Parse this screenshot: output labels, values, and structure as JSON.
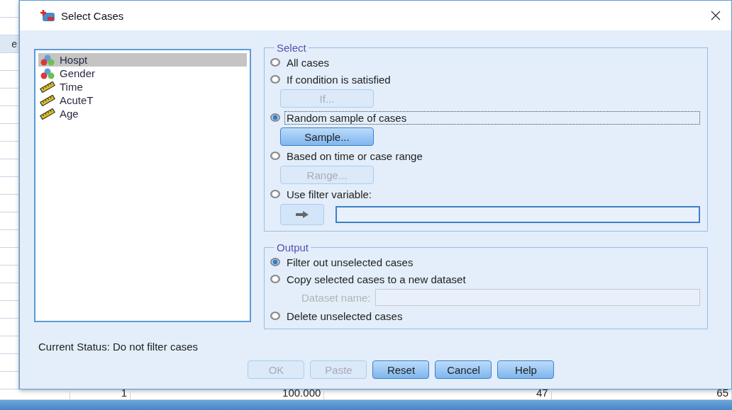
{
  "background": {
    "header_fragment": "e",
    "row": [
      "1",
      "100.000",
      "47",
      "65"
    ]
  },
  "window": {
    "title": "Select Cases"
  },
  "variables": [
    {
      "name": "Hospt",
      "kind": "nominal",
      "selected": true
    },
    {
      "name": "Gender",
      "kind": "nominal",
      "selected": false
    },
    {
      "name": "Time",
      "kind": "scale",
      "selected": false
    },
    {
      "name": "AcuteT",
      "kind": "scale",
      "selected": false
    },
    {
      "name": "Age",
      "kind": "scale",
      "selected": false
    }
  ],
  "select": {
    "title": "Select",
    "options": [
      {
        "kind": "radio",
        "label": "All cases",
        "selected": false
      },
      {
        "kind": "radio",
        "label": "If condition is satisfied",
        "selected": false
      },
      {
        "kind": "button",
        "label": "If...",
        "disabled": true
      },
      {
        "kind": "radio",
        "label": "Random sample of cases",
        "selected": true,
        "focused": true
      },
      {
        "kind": "button",
        "label": "Sample...",
        "disabled": false
      },
      {
        "kind": "radio",
        "label": "Based on time or case range",
        "selected": false
      },
      {
        "kind": "button",
        "label": "Range...",
        "disabled": true
      },
      {
        "kind": "radio",
        "label": "Use filter variable:",
        "selected": false
      },
      {
        "kind": "move",
        "disabled": true
      }
    ]
  },
  "output": {
    "title": "Output",
    "options": [
      {
        "kind": "radio",
        "label": "Filter out unselected cases",
        "selected": true
      },
      {
        "kind": "radio",
        "label": "Copy selected cases to a new dataset",
        "selected": false
      },
      {
        "kind": "field",
        "label": "Dataset name:",
        "disabled": true
      },
      {
        "kind": "radio",
        "label": "Delete unselected cases",
        "selected": false
      }
    ]
  },
  "status": "Current Status: Do not filter cases",
  "buttons": [
    {
      "label": "OK",
      "disabled": true
    },
    {
      "label": "Paste",
      "disabled": true
    },
    {
      "label": "Reset",
      "disabled": false
    },
    {
      "label": "Cancel",
      "disabled": false
    },
    {
      "label": "Help",
      "disabled": false
    }
  ]
}
